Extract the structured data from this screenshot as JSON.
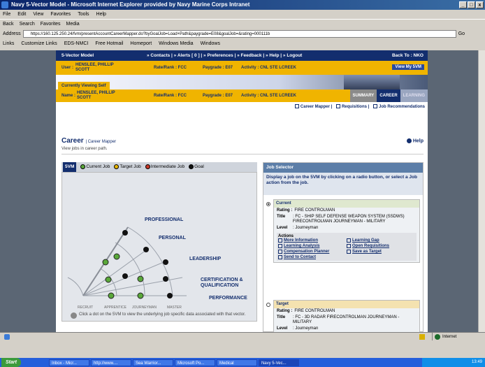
{
  "window": {
    "title": "Navy 5-Vector Model - Microsoft Internet Explorer provided by Navy Marine Corps Intranet"
  },
  "menu": [
    "File",
    "Edit",
    "View",
    "Favorites",
    "Tools",
    "Help"
  ],
  "toolbar": [
    "Back",
    "Search",
    "Favorites",
    "Media"
  ],
  "address": {
    "label": "Address",
    "url": "https://160.125.250.24/fvm/presentAccountCareerMapper.do?byGoalJob=Load+Path&paygrade=E08&goalJob=&rating=000111b",
    "go": "Go"
  },
  "links": {
    "label": "Links",
    "items": [
      "Customize Links",
      "EDS-NMCI",
      "Free Hotmail",
      "Homeport",
      "Windows Media",
      "Windows"
    ]
  },
  "site": {
    "brand": "5-Vector Model",
    "nav": "» Contacts | » Alerts [ 0 ] | » Preferences | » Feedback | » Help | » Logout",
    "back": "Back To : NKO",
    "user": {
      "label": "User :",
      "name": "HENSLEE, PHILLIP SCOTT",
      "rank": "Rate/Rank : FCC",
      "paygrade": "Paygrade : E07",
      "activity": "Activity : CNL STE LCREEK",
      "view_svm": "View My 5VM"
    },
    "viewing_tab": "Currently Viewing Self",
    "viewing": {
      "label": "Name :",
      "name": "HENSLEE, PHILLIP SCOTT",
      "rank": "Rate/Rank : FCC",
      "paygrade": "Paygrade : E07",
      "activity": "Activity : CNL STE LCREEK"
    },
    "tabs": [
      "SUMMARY",
      "CAREER",
      "LEARNING"
    ],
    "subnav": [
      "Career Mapper",
      "Requisitions",
      "Job Recommendations"
    ]
  },
  "main": {
    "title": "Career",
    "crumb": "| Career Mapper",
    "help": "Help",
    "subtitle": "View jobs in career path.",
    "legend": {
      "svm": "5VM",
      "items": [
        "Current Job",
        "Target Job",
        "Intermediate Job",
        "Goal"
      ]
    },
    "vectors": [
      "PROFESSIONAL",
      "PERSONAL",
      "LEADERSHIP",
      "CERTIFICATION & QUALIFICATION",
      "PERFORMANCE"
    ],
    "axis": [
      "RECRUIT",
      "APPRENTICE",
      "JOURNEYMAN",
      "MASTER"
    ],
    "hint": "Click a dot on the 5VM to view the underlying job specific data associated with that vector."
  },
  "job_selector": {
    "title": "Job Selector",
    "desc": "Display a job on the 5VM by clicking on a radio button, or select a Job action from the job.",
    "current": {
      "heading": "Current",
      "rating_label": "Rating :",
      "rating": "FIRE CONTROLMAN",
      "title_label": "Title",
      "title": ": FC - SHIP SELF DEFENSE WEAPON SYSTEM (SSDWS) FIRECONTROLMAN JOURNEYMAN - MILITARY",
      "level_label": "Level",
      "level": ": Journeyman",
      "actions_label": "Actions",
      "actions": [
        "More Information",
        "Learning Gap",
        "Learning Analysis",
        "Open Requisitions",
        "Compensation Planner",
        "Save as Target",
        "Send to Contact"
      ]
    },
    "target": {
      "heading": "Target",
      "rating_label": "Rating :",
      "rating": "FIRE CONTROLMAN",
      "title_label": "Title",
      "title": ": FC - 3D RADAR FIRECONTROLMAN JOURNEYMAN - MILITARY",
      "level_label": "Level",
      "level": ": Journeyman"
    }
  },
  "status": {
    "zone": "Internet"
  },
  "taskbar": {
    "start": "Start",
    "tasks": [
      "Inbox - Micr...",
      "http://www....",
      "Sea Warrior...",
      "Microsoft Po...",
      "Medical",
      "Navy 5-Vec..."
    ],
    "clock": "13:49"
  },
  "colors": {
    "navy": "#132e6e",
    "gold": "#f0b400",
    "green": "#5aa83a"
  }
}
